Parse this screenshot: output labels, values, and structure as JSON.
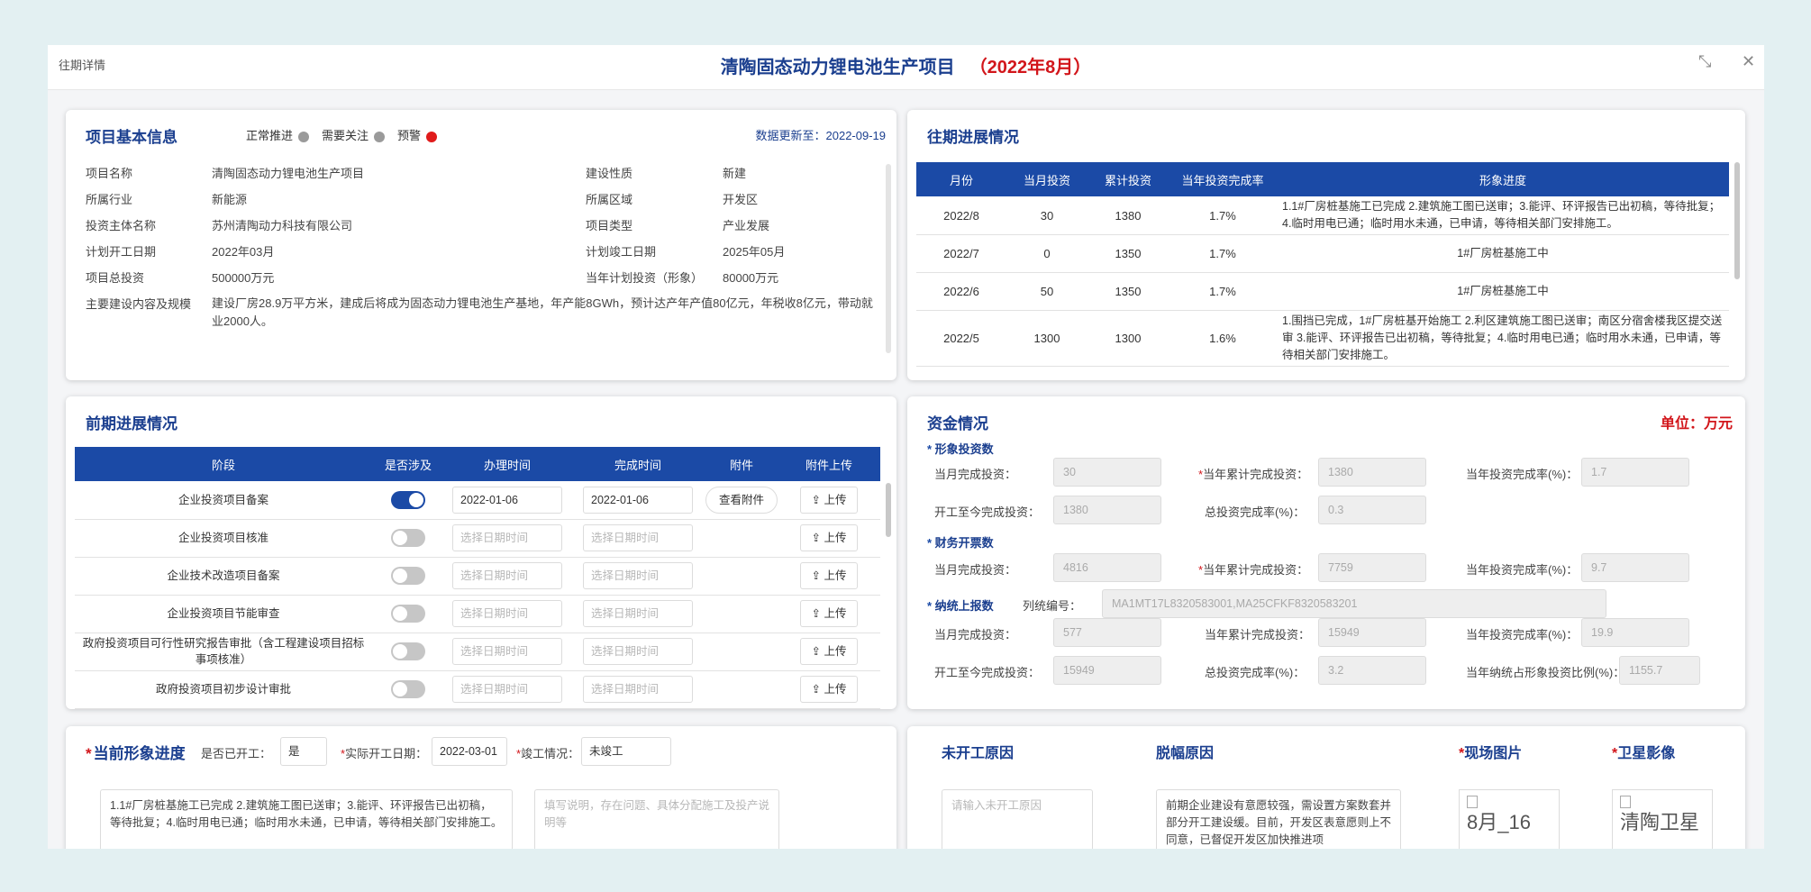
{
  "window": {
    "label": "往期详情",
    "title": "清陶固态动力锂电池生产项目",
    "title_month": "（2022年8月）",
    "expand_icon": "⤡",
    "close_icon": "✕"
  },
  "basic": {
    "title": "项目基本信息",
    "legend": [
      {
        "label": "正常推进",
        "color": "#9a9a9a"
      },
      {
        "label": "需要关注",
        "color": "#9a9a9a"
      },
      {
        "label": "预警",
        "color": "#e01b1b"
      }
    ],
    "update_label": "数据更新至：",
    "update_date": "2022-09-19",
    "rows": [
      {
        "k1": "项目名称",
        "v1": "清陶固态动力锂电池生产项目",
        "k2": "建设性质",
        "v2": "新建"
      },
      {
        "k1": "所属行业",
        "v1": "新能源",
        "k2": "所属区域",
        "v2": "开发区"
      },
      {
        "k1": "投资主体名称",
        "v1": "苏州清陶动力科技有限公司",
        "k2": "项目类型",
        "v2": "产业发展"
      },
      {
        "k1": "计划开工日期",
        "v1": "2022年03月",
        "k2": "计划竣工日期",
        "v2": "2025年05月"
      },
      {
        "k1": "项目总投资",
        "v1": "500000万元",
        "k2": "当年计划投资（形象）",
        "v2": "80000万元"
      }
    ],
    "desc_label": "主要建设内容及规模",
    "desc_value": "建设厂房28.9万平方米，建成后将成为固态动力锂电池生产基地，年产能8GWh，预计达产年产值80亿元，年税收8亿元，带动就业2000人。"
  },
  "past_progress": {
    "title": "往期进展情况",
    "headers": [
      "月份",
      "当月投资",
      "累计投资",
      "当年投资完成率",
      "形象进度"
    ],
    "rows": [
      {
        "month": "2022/8",
        "cur": "30",
        "total": "1380",
        "rate": "1.7%",
        "img": "1.1#厂房桩基施工已完成 2.建筑施工图已送审；3.能评、环评报告已出初稿，等待批复；4.临时用电已通；临时用水未通，已申请，等待相关部门安排施工。"
      },
      {
        "month": "2022/7",
        "cur": "0",
        "total": "1350",
        "rate": "1.7%",
        "img": "1#厂房桩基施工中"
      },
      {
        "month": "2022/6",
        "cur": "50",
        "total": "1350",
        "rate": "1.7%",
        "img": "1#厂房桩基施工中"
      },
      {
        "month": "2022/5",
        "cur": "1300",
        "total": "1300",
        "rate": "1.6%",
        "img": "1.围挡已完成，1#厂房桩基开始施工 2.利区建筑施工图已送审；南区分宿舍楼我区提交送审 3.能评、环评报告已出初稿，等待批复；4.临时用电已通；临时用水未通，已申请，等待相关部门安排施工。"
      }
    ]
  },
  "early": {
    "title": "前期进展情况",
    "headers": [
      "阶段",
      "是否涉及",
      "办理时间",
      "完成时间",
      "附件",
      "附件上传"
    ],
    "view_label": "查看附件",
    "upload_label": "上传",
    "upload_icon": "⇪",
    "placeholder": "选择日期时间",
    "rows": [
      {
        "stage": "企业投资项目备案",
        "on": true,
        "start": "2022-01-06",
        "end": "2022-01-06",
        "has_file": true
      },
      {
        "stage": "企业投资项目核准",
        "on": false,
        "start": "",
        "end": "",
        "has_file": false
      },
      {
        "stage": "企业技术改造项目备案",
        "on": false,
        "start": "",
        "end": "",
        "has_file": false
      },
      {
        "stage": "企业投资项目节能审查",
        "on": false,
        "start": "",
        "end": "",
        "has_file": false
      },
      {
        "stage": "政府投资项目可行性研究报告审批（含工程建设项目招标事项核准）",
        "on": false,
        "start": "",
        "end": "",
        "has_file": false
      },
      {
        "stage": "政府投资项目初步设计审批",
        "on": false,
        "start": "",
        "end": "",
        "has_file": false
      }
    ]
  },
  "funds": {
    "title": "资金情况",
    "unit": "单位：万元",
    "sec1": "形象投资数",
    "sec2": "财务开票数",
    "sec3": "纳统上报数",
    "cur_month_label": "当月完成投资：",
    "year_total_label": "当年累计完成投资：",
    "year_rate_label": "当年投资完成率(%)：",
    "since_start_label": "开工至今完成投资：",
    "total_rate_label": "总投资完成率(%)：",
    "stat_code_label": "列统编号：",
    "ratio_label": "当年纳统占形象投资比例(%)：",
    "image": {
      "cur": "30",
      "year": "1380",
      "rate": "1.7",
      "since": "1380",
      "total_rate": "0.3"
    },
    "finance": {
      "cur": "4816",
      "year": "7759",
      "rate": "9.7"
    },
    "stats": {
      "code": "MA1MT17L8320583001,MA25CFKF8320583201",
      "cur": "577",
      "year": "15949",
      "rate": "19.9",
      "since": "15949",
      "total_rate": "3.2",
      "ratio": "1155.7"
    }
  },
  "current": {
    "title": "当前形象进度",
    "started_label": "是否已开工：",
    "started_value": "是",
    "actual_date_label": "实际开工日期：",
    "actual_date_value": "2022-03-01",
    "completion_label": "竣工情况：",
    "completion_value": "未竣工",
    "progress_text": "1.1#厂房桩基施工已完成 2.建筑施工图已送审；3.能评、环评报告已出初稿，等待批复；4.临时用电已通；临时用水未通，已申请，等待相关部门安排施工。",
    "issue_placeholder": "填写说明，存在问题、具体分配施工及投产说明等"
  },
  "reasons": {
    "not_started_title": "未开工原因",
    "not_started_placeholder": "请输入未开工原因",
    "lag_title": "脱幅原因",
    "lag_text": "前期企业建设有意愿较强，需设置方案数套并部分开工建设缓。目前，开发区表意愿则上不同意，已督促开发区加快推进项",
    "site_photo_title": "现场图片",
    "site_photo_alt": "8月_16",
    "satellite_title": "卫星影像",
    "satellite_alt": "清陶卫星"
  }
}
